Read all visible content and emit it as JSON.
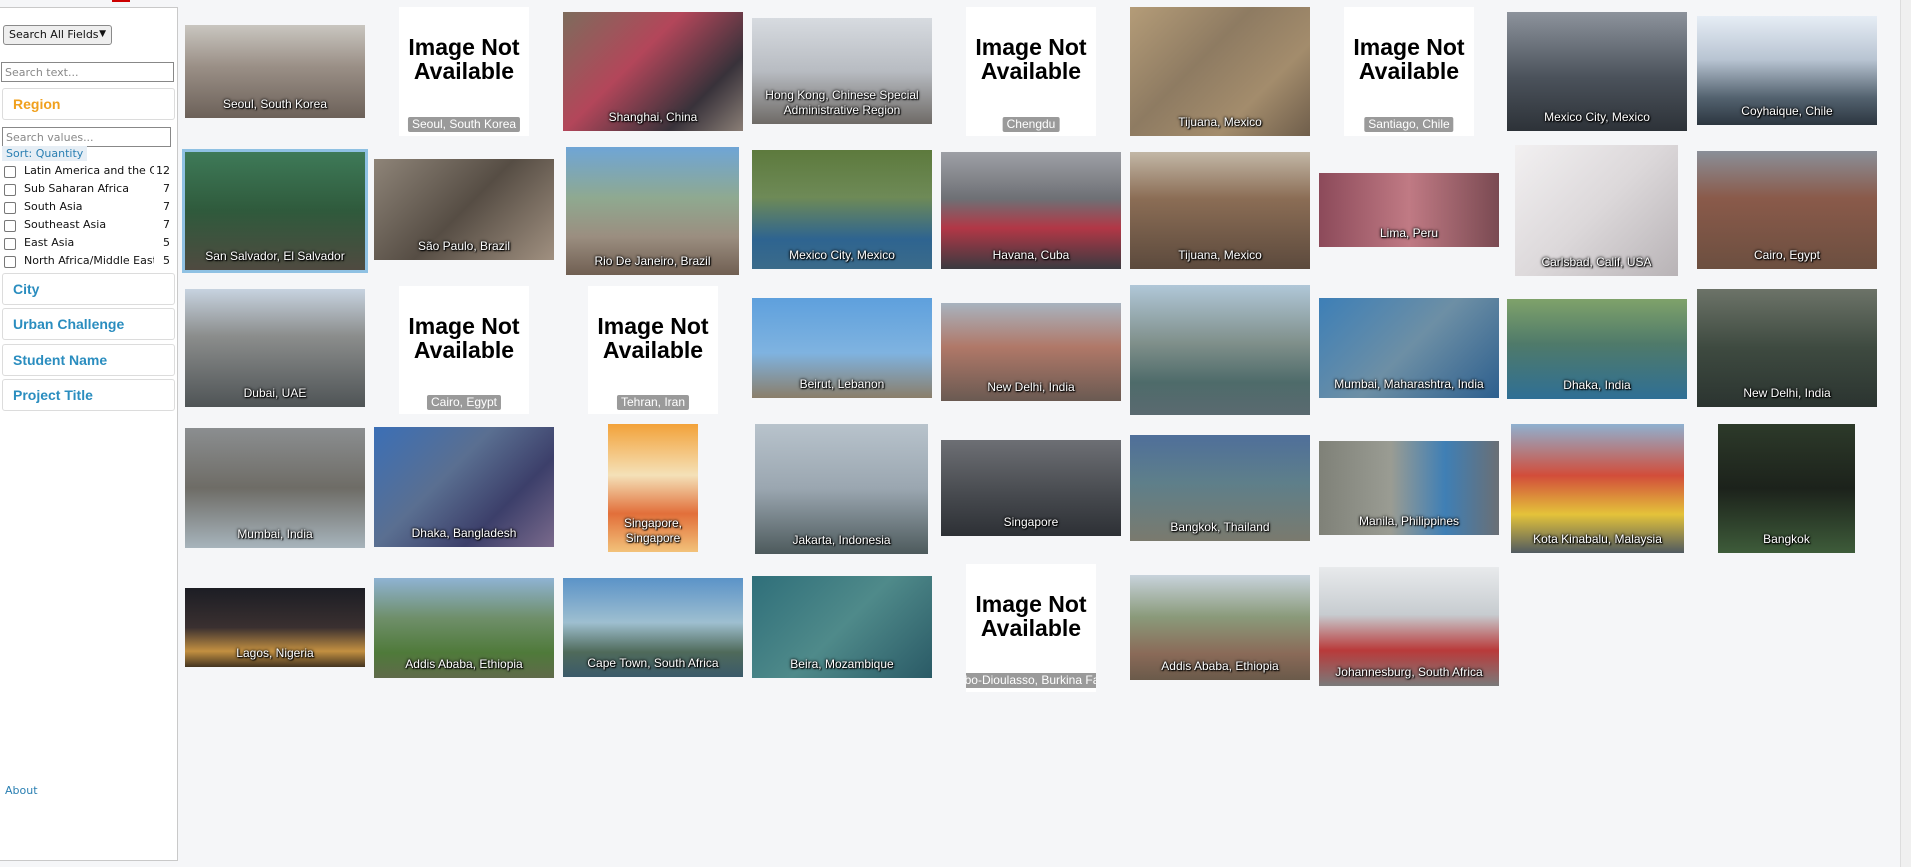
{
  "sidebar": {
    "field_select": "Search All Fields",
    "search_text_placeholder": "Search text...",
    "region_header": "Region",
    "search_values_placeholder": "Search values...",
    "sort_label": "Sort: Quantity",
    "regions": [
      {
        "label": "Latin America and the Caribbean",
        "count": "12"
      },
      {
        "label": "Sub Saharan Africa",
        "count": "7"
      },
      {
        "label": "South Asia",
        "count": "7"
      },
      {
        "label": "Southeast Asia",
        "count": "7"
      },
      {
        "label": "East Asia",
        "count": "5"
      },
      {
        "label": "North Africa/Middle East",
        "count": "5"
      }
    ],
    "facets": [
      "City",
      "Urban Challenge",
      "Student Name",
      "Project Title"
    ],
    "about": "About"
  },
  "na_text": "Image Not Available",
  "tiles": [
    "Seoul, South Korea",
    "Seoul, South Korea",
    "Shanghai, China",
    "Hong Kong, Chinese Special Administrative Region",
    "Chengdu",
    "Tijuana, Mexico",
    "Santiago, Chile",
    "Mexico City, Mexico",
    "Coyhaique, Chile",
    "San Salvador, El Salvador",
    "São Paulo, Brazil",
    "Rio De Janeiro, Brazil",
    "Mexico City, Mexico",
    "Havana, Cuba",
    "Tijuana, Mexico",
    "Lima, Peru",
    "Carlsbad, Calif, USA",
    "Cairo, Egypt",
    "Dubai, UAE",
    "Cairo, Egypt",
    "Tehran, Iran",
    "Beirut, Lebanon",
    "New Delhi, India",
    "",
    "Mumbai, Maharashtra, India",
    "Dhaka, India",
    "New Delhi, India",
    "Mumbai, India",
    "Dhaka, Bangladesh",
    "Singapore, Singapore",
    "Jakarta, Indonesia",
    "Singapore",
    "Bangkok, Thailand",
    "Manila, Philippines",
    "Kota Kinabalu, Malaysia",
    "Bangkok",
    "Lagos, Nigeria",
    "Addis Ababa, Ethiopia",
    "Cape Town, South Africa",
    "Beira, Mozambique",
    "Bobo-Dioulasso, Burkina Faso",
    "Addis Ababa, Ethiopia",
    "Johannesburg, South Africa"
  ]
}
